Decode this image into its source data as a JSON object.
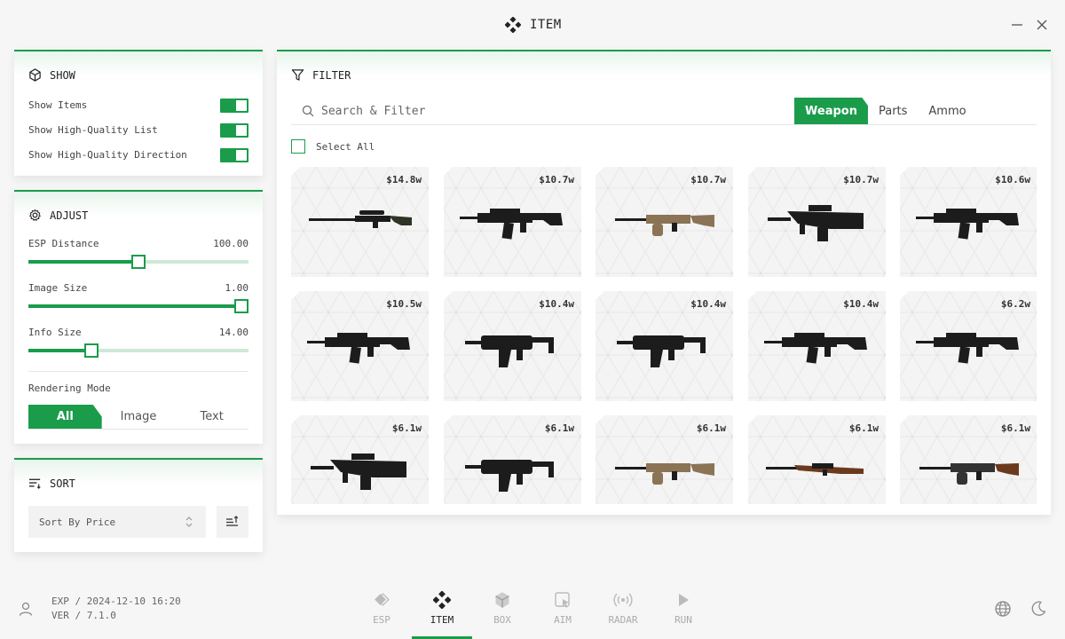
{
  "window": {
    "title": "ITEM"
  },
  "show_panel": {
    "title": "SHOW",
    "items": [
      {
        "label": "Show Items",
        "on": true
      },
      {
        "label": "Show High-Quality List",
        "on": true
      },
      {
        "label": "Show High-Quality Direction",
        "on": true
      }
    ]
  },
  "adjust_panel": {
    "title": "ADJUST",
    "sliders": [
      {
        "label": "ESP Distance",
        "value": "100.00",
        "fraction": 0.5
      },
      {
        "label": "Image Size",
        "value": "1.00",
        "fraction": 1.0
      },
      {
        "label": "Info Size",
        "value": "14.00",
        "fraction": 0.27
      }
    ],
    "rendering_mode_label": "Rendering Mode",
    "rendering_modes": [
      "All",
      "Image",
      "Text"
    ],
    "rendering_mode_selected": "All"
  },
  "sort_panel": {
    "title": "SORT",
    "select_value": "Sort By Price"
  },
  "filter_panel": {
    "title": "FILTER",
    "search_placeholder": "Search & Filter",
    "tabs": [
      "Weapon",
      "Parts",
      "Ammo"
    ],
    "active_tab": "Weapon",
    "select_all_label": "Select All",
    "items": [
      {
        "price": "$14.8w",
        "icon": "sniper-rifle-icon"
      },
      {
        "price": "$10.7w",
        "icon": "assault-rifle-icon"
      },
      {
        "price": "$10.7w",
        "icon": "light-machine-gun-icon"
      },
      {
        "price": "$10.7w",
        "icon": "bullpup-rifle-icon"
      },
      {
        "price": "$10.6w",
        "icon": "assault-rifle-icon"
      },
      {
        "price": "$10.5w",
        "icon": "carbine-icon"
      },
      {
        "price": "$10.4w",
        "icon": "smg-icon"
      },
      {
        "price": "$10.4w",
        "icon": "smg-icon"
      },
      {
        "price": "$10.4w",
        "icon": "assault-rifle-icon"
      },
      {
        "price": "$6.2w",
        "icon": "assault-rifle-icon"
      },
      {
        "price": "$6.1w",
        "icon": "bullpup-rifle-icon"
      },
      {
        "price": "$6.1w",
        "icon": "pdw-icon"
      },
      {
        "price": "$6.1w",
        "icon": "light-machine-gun-icon"
      },
      {
        "price": "$6.1w",
        "icon": "bolt-rifle-icon"
      },
      {
        "price": "$6.1w",
        "icon": "machine-gun-icon"
      }
    ]
  },
  "footer": {
    "exp": "EXP / 2024-12-10 16:20",
    "ver": "VER / 7.1.0",
    "nav": [
      {
        "label": "ESP",
        "icon": "esp-icon"
      },
      {
        "label": "ITEM",
        "icon": "item-icon"
      },
      {
        "label": "BOX",
        "icon": "box-icon"
      },
      {
        "label": "AIM",
        "icon": "aim-icon"
      },
      {
        "label": "RADAR",
        "icon": "radar-icon"
      },
      {
        "label": "RUN",
        "icon": "run-icon"
      }
    ],
    "active_nav": "ITEM"
  },
  "colors": {
    "accent": "#1a9c4b",
    "background": "#f6f6f6"
  }
}
